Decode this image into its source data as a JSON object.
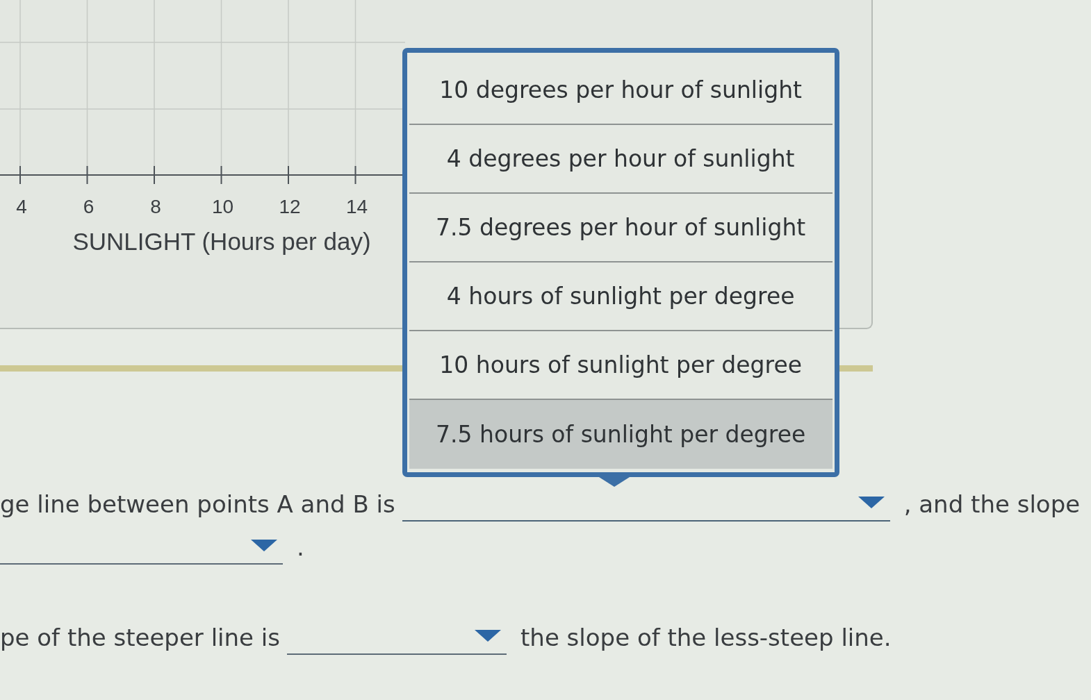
{
  "graph": {
    "x_tick_labels": [
      "4",
      "6",
      "8",
      "10",
      "12",
      "14"
    ],
    "x_axis_label": "SUNLIGHT (Hours per day)"
  },
  "sentences": [
    {
      "parts": [
        {
          "kind": "text",
          "text": "ge line between points A and B is"
        },
        {
          "kind": "blank",
          "expanded": true,
          "options": [
            {
              "label": "10 degrees per hour of sunlight",
              "selected": false
            },
            {
              "label": "4 degrees per hour of sunlight",
              "selected": false
            },
            {
              "label": "7.5 degrees per hour of sunlight",
              "selected": false
            },
            {
              "label": "4 hours of sunlight per degree",
              "selected": false
            },
            {
              "label": "10 hours of sunlight per degree",
              "selected": false
            },
            {
              "label": "7.5 hours of sunlight per degree",
              "selected": true
            }
          ]
        },
        {
          "kind": "text",
          "text": ", and the slope"
        }
      ]
    },
    {
      "parts": [
        {
          "kind": "blank",
          "expanded": false
        },
        {
          "kind": "text",
          "text": "."
        }
      ]
    },
    {
      "parts": [
        {
          "kind": "text",
          "text": "pe of the steeper line is"
        },
        {
          "kind": "blank",
          "expanded": false
        },
        {
          "kind": "text",
          "text": "the slope of the less-steep line."
        }
      ]
    }
  ]
}
